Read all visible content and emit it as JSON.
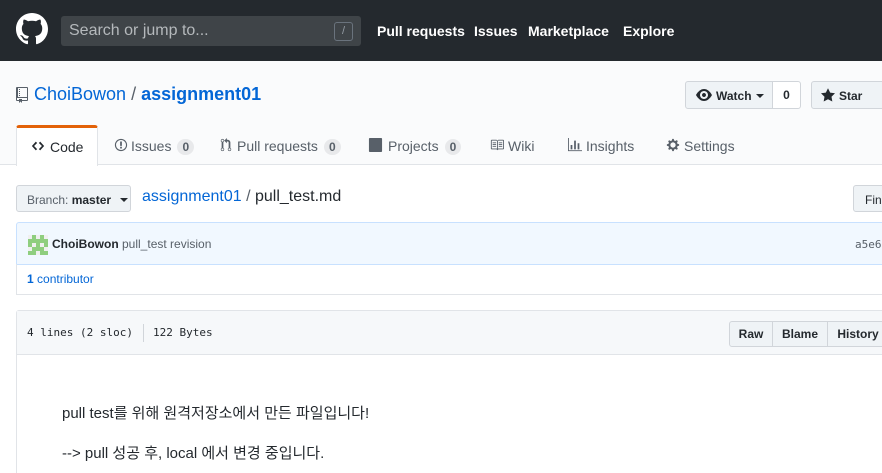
{
  "header": {
    "search_placeholder": "Search or jump to...",
    "slash_key": "/",
    "nav": [
      "Pull requests",
      "Issues",
      "Marketplace",
      "Explore"
    ]
  },
  "repo": {
    "owner": "ChoiBowon",
    "separator": "/",
    "name": "assignment01",
    "watch_label": "Watch",
    "watch_count": "0",
    "star_label": "Star"
  },
  "tabs": [
    {
      "label": "Code",
      "count": null
    },
    {
      "label": "Issues",
      "count": "0"
    },
    {
      "label": "Pull requests",
      "count": "0"
    },
    {
      "label": "Projects",
      "count": "0"
    },
    {
      "label": "Wiki",
      "count": null
    },
    {
      "label": "Insights",
      "count": null
    },
    {
      "label": "Settings",
      "count": null
    }
  ],
  "filenav": {
    "branch_prefix": "Branch:",
    "branch": "master",
    "path_root": "assignment01",
    "path_sep": "/",
    "file_name": "pull_test.md",
    "find_label": "Find"
  },
  "commit": {
    "author": "ChoiBowon",
    "message": "pull_test revision",
    "sha": "a5e6",
    "contributor_count": "1",
    "contributor_label": "contributor"
  },
  "file": {
    "lines": "4 lines (2 sloc)",
    "size": "122 Bytes",
    "actions": [
      "Raw",
      "Blame",
      "History"
    ],
    "content": [
      "pull test를 위해 원격저장소에서 만든 파일입니다!",
      "--> pull 성공 후, local 에서 변경 중입니다."
    ]
  },
  "colors": {
    "header_bg": "#24292e",
    "link": "#0366d6",
    "active_tab": "#e36209",
    "commit_bg": "#f1f8ff"
  }
}
